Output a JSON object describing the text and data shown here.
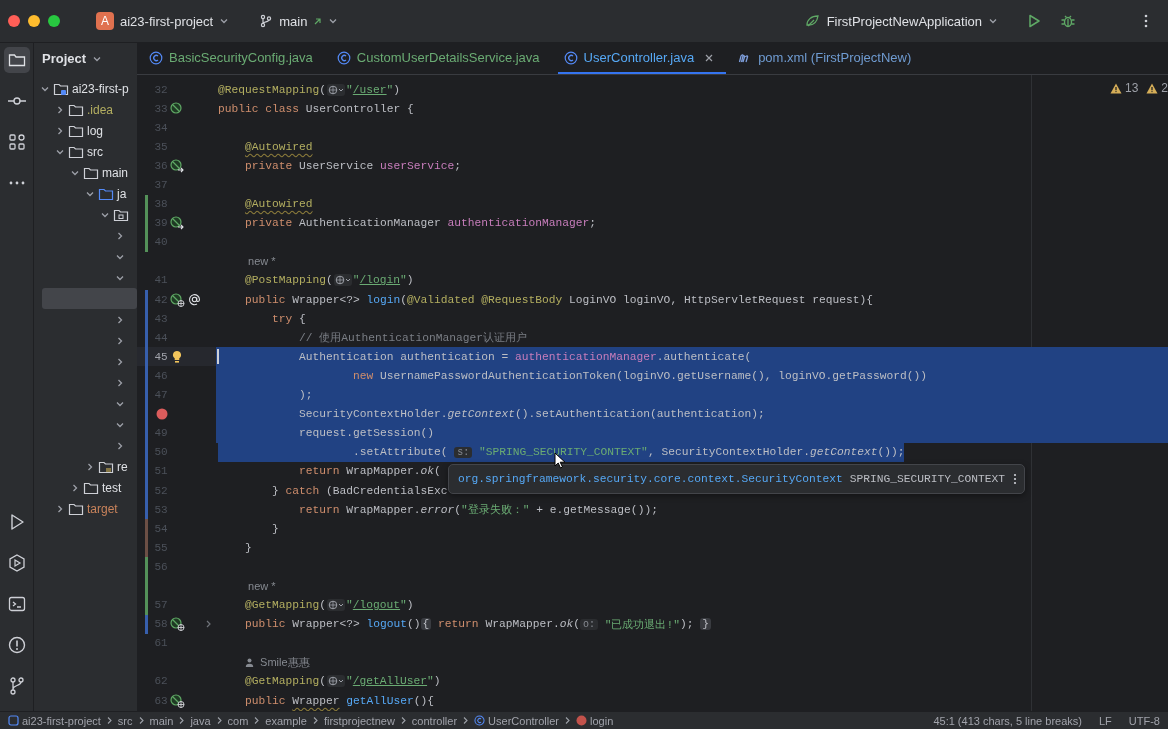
{
  "titlebar": {
    "project_badge": "A",
    "project": "ai23-first-project",
    "branch": "main",
    "run_config": "FirstProjectNewApplication"
  },
  "project": {
    "title": "Project",
    "tree": [
      {
        "label": "ai23-first-p",
        "kind": "module",
        "expanded": true,
        "selected": false,
        "children": [
          {
            "label": ".idea",
            "kind": "folder",
            "expanded": false,
            "selected": false,
            "color": "#b3ae60"
          },
          {
            "label": "log",
            "kind": "folder",
            "expanded": false,
            "selected": false
          },
          {
            "label": "src",
            "kind": "folder",
            "expanded": true,
            "selected": false,
            "children": [
              {
                "label": "main",
                "kind": "folder",
                "expanded": true,
                "selected": false,
                "children": [
                  {
                    "label": "ja",
                    "kind": "source",
                    "expanded": true,
                    "selected": false,
                    "children": [
                      {
                        "kind": "package",
                        "expanded": true,
                        "selected": false,
                        "children": [
                          {
                            "expanded": false,
                            "selected": false
                          },
                          {
                            "expanded": true,
                            "selected": false
                          },
                          {
                            "expanded": true,
                            "selected": false
                          },
                          {
                            "selected": true
                          },
                          {
                            "expanded": false,
                            "selected": false
                          },
                          {
                            "expanded": false,
                            "selected": false
                          },
                          {
                            "expanded": false,
                            "selected": false
                          },
                          {
                            "expanded": false,
                            "selected": false
                          },
                          {
                            "expanded": true,
                            "selected": false
                          },
                          {
                            "expanded": true,
                            "selected": false
                          },
                          {
                            "expanded": false,
                            "selected": false
                          }
                        ]
                      }
                    ]
                  },
                  {
                    "label": "re",
                    "kind": "resources",
                    "expanded": false,
                    "selected": false
                  }
                ]
              },
              {
                "label": "test",
                "kind": "folder",
                "expanded": false,
                "selected": false
              }
            ]
          },
          {
            "label": "target",
            "kind": "folder",
            "expanded": false,
            "selected": false,
            "color": "#c9835b"
          }
        ]
      }
    ]
  },
  "tabs": [
    {
      "label": "BasicSecurityConfig.java",
      "kind": "class",
      "selected": false,
      "color": "#6aab73"
    },
    {
      "label": "CustomUserDetailsService.java",
      "kind": "class",
      "selected": false,
      "color": "#6aab73"
    },
    {
      "label": "UserController.java",
      "kind": "class",
      "selected": true,
      "color": "#56a8f5"
    },
    {
      "label": "pom.xml (FirstProjectNew)",
      "kind": "maven",
      "selected": false,
      "color": "#6f9bd1"
    }
  ],
  "editor": {
    "warnings": [
      "13",
      "2"
    ],
    "lines": [
      {
        "kind": "code",
        "number": "32",
        "tokens": [
          {
            "kind": "ann",
            "text": "@RequestMapping"
          },
          {
            "kind": "p",
            "text": "("
          },
          {
            "kind": "globe"
          },
          {
            "kind": "str",
            "text": "\""
          },
          {
            "kind": "url",
            "text": "/user"
          },
          {
            "kind": "str",
            "text": "\""
          },
          {
            "kind": "p",
            "text": ")"
          }
        ]
      },
      {
        "kind": "code",
        "number": "33",
        "gutter": [
          {
            "kind": "bean"
          }
        ],
        "tokens": [
          {
            "kind": "kw",
            "text": "public class "
          },
          {
            "kind": "p",
            "text": "UserController {"
          }
        ]
      },
      {
        "kind": "code",
        "number": "34"
      },
      {
        "kind": "code",
        "number": "35",
        "tokens": [
          {
            "kind": "ann_warn",
            "text": "    @Autowired"
          }
        ]
      },
      {
        "kind": "code",
        "number": "36",
        "gutter": [
          {
            "kind": "bean_arrow"
          }
        ],
        "tokens": [
          {
            "kind": "kw",
            "text": "    private "
          },
          {
            "kind": "p",
            "text": "UserService "
          },
          {
            "kind": "field",
            "text": "userService"
          },
          {
            "kind": "p",
            "text": ";"
          }
        ]
      },
      {
        "kind": "code",
        "number": "37"
      },
      {
        "kind": "code",
        "number": "38",
        "color": "#549159",
        "tokens": [
          {
            "kind": "ann_warn",
            "text": "    @Autowired"
          }
        ]
      },
      {
        "kind": "code",
        "number": "39",
        "color": "#549159",
        "gutter": [
          {
            "kind": "bean_arrow"
          }
        ],
        "tokens": [
          {
            "kind": "kw",
            "text": "    private "
          },
          {
            "kind": "p",
            "text": "AuthenticationManager "
          },
          {
            "kind": "field",
            "text": "authenticationManager"
          },
          {
            "kind": "p",
            "text": ";"
          }
        ]
      },
      {
        "kind": "code",
        "number": "40",
        "color": "#549159"
      },
      {
        "kind": "inlay",
        "text": "new *"
      },
      {
        "kind": "code",
        "number": "41",
        "tokens": [
          {
            "kind": "ann",
            "text": "    @PostMapping"
          },
          {
            "kind": "p",
            "text": "("
          },
          {
            "kind": "globe"
          },
          {
            "kind": "str",
            "text": "\""
          },
          {
            "kind": "url",
            "text": "/login"
          },
          {
            "kind": "str",
            "text": "\""
          },
          {
            "kind": "p",
            "text": ")"
          }
        ]
      },
      {
        "kind": "code",
        "number": "42",
        "color": "#375fad",
        "gutter": [
          {
            "kind": "bean_globe"
          },
          {
            "kind": "at"
          }
        ],
        "tokens": [
          {
            "kind": "kw",
            "text": "    public "
          },
          {
            "kind": "p",
            "text": "Wrapper<?> "
          },
          {
            "kind": "fn",
            "text": "login"
          },
          {
            "kind": "p",
            "text": "("
          },
          {
            "kind": "ann",
            "text": "@Validated @RequestBody "
          },
          {
            "kind": "p",
            "text": "LoginVO loginVO, HttpServletRequest request){"
          }
        ]
      },
      {
        "kind": "code",
        "number": "43",
        "color": "#375fad",
        "tokens": [
          {
            "kind": "kw",
            "text": "        try "
          },
          {
            "kind": "p",
            "text": "{"
          }
        ]
      },
      {
        "kind": "code",
        "number": "44",
        "color": "#375fad",
        "tokens": [
          {
            "kind": "cm",
            "text": "            // 使用AuthenticationManager认证用户"
          }
        ]
      },
      {
        "kind": "code",
        "number": "45",
        "color": "#375fad",
        "current": true,
        "selected": true,
        "gutter": [
          {
            "kind": "bulb"
          }
        ],
        "tokens": [
          {
            "kind": "p",
            "text": "            Authentication authentication = "
          },
          {
            "kind": "field",
            "text": "authenticationManager"
          },
          {
            "kind": "p",
            "text": ".authenticate("
          }
        ]
      },
      {
        "kind": "code",
        "number": "46",
        "color": "#375fad",
        "selected": true,
        "tokens": [
          {
            "kind": "kw",
            "text": "                    new "
          },
          {
            "kind": "p",
            "text": "UsernamePasswordAuthenticationToken(loginVO.getUsername(), loginVO.getPassword())"
          }
        ]
      },
      {
        "kind": "code",
        "number": "47",
        "color": "#375fad",
        "selected": true,
        "tokens": [
          {
            "kind": "p",
            "text": "            );"
          }
        ]
      },
      {
        "kind": "code",
        "color": "#375fad",
        "selected": true,
        "gutter": [
          {
            "kind": "breakpoint"
          }
        ],
        "tokens": [
          {
            "kind": "p",
            "text": "            SecurityContextHolder."
          },
          {
            "kind": "it",
            "text": "getContext"
          },
          {
            "kind": "p",
            "text": "().setAuthentication(authentication);"
          }
        ]
      },
      {
        "kind": "code",
        "number": "49",
        "color": "#375fad",
        "selected": true,
        "tokens": [
          {
            "kind": "p",
            "text": "            request.getSession()"
          }
        ]
      },
      {
        "kind": "code",
        "number": "50",
        "color": "#375fad",
        "selected": true,
        "tokens": [
          {
            "kind": "p",
            "text": "                    .setAttribute( "
          },
          {
            "kind": "hint",
            "text": "s:"
          },
          {
            "kind": "str",
            "text": " \"SPRING_SECURITY_CONTEXT\""
          },
          {
            "kind": "p",
            "text": ", SecurityContextHolder."
          },
          {
            "kind": "it",
            "text": "getContext"
          },
          {
            "kind": "p",
            "text": "());"
          }
        ]
      },
      {
        "kind": "code",
        "number": "51",
        "color": "#375fad",
        "tokens": [
          {
            "kind": "kw",
            "text": "            return "
          },
          {
            "kind": "p",
            "text": "WrapMapper."
          },
          {
            "kind": "it",
            "text": "ok"
          },
          {
            "kind": "p",
            "text": "("
          }
        ]
      },
      {
        "kind": "code",
        "number": "52",
        "color": "#375fad",
        "tokens": [
          {
            "kind": "p",
            "text": "        } "
          },
          {
            "kind": "kw",
            "text": "catch "
          },
          {
            "kind": "p",
            "text": "(BadCredentialsExc"
          }
        ]
      },
      {
        "kind": "code",
        "number": "53",
        "color": "#375fad",
        "tokens": [
          {
            "kind": "kw",
            "text": "            return "
          },
          {
            "kind": "p",
            "text": "WrapMapper."
          },
          {
            "kind": "it",
            "text": "error"
          },
          {
            "kind": "p",
            "text": "("
          },
          {
            "kind": "str",
            "text": "\"登录失败：\""
          },
          {
            "kind": "p",
            "text": " + e.getMessage());"
          }
        ]
      },
      {
        "kind": "code",
        "number": "54",
        "color": "#6c4f45",
        "tokens": [
          {
            "kind": "p",
            "text": "        }"
          }
        ]
      },
      {
        "kind": "code",
        "number": "55",
        "color": "#6c4f45",
        "tokens": [
          {
            "kind": "p",
            "text": "    }"
          }
        ]
      },
      {
        "kind": "code",
        "number": "56",
        "color": "#549159"
      },
      {
        "kind": "inlay",
        "text": "new *",
        "color": "#549159"
      },
      {
        "kind": "code",
        "number": "57",
        "color": "#549159",
        "tokens": [
          {
            "kind": "ann",
            "text": "    @GetMapping"
          },
          {
            "kind": "p",
            "text": "("
          },
          {
            "kind": "globe"
          },
          {
            "kind": "str",
            "text": "\""
          },
          {
            "kind": "url",
            "text": "/logout"
          },
          {
            "kind": "str",
            "text": "\""
          },
          {
            "kind": "p",
            "text": ")"
          }
        ]
      },
      {
        "kind": "code",
        "number": "58",
        "color": "#375fad",
        "gutter": [
          {
            "kind": "bean_globe"
          },
          {
            "kind": "fold"
          }
        ],
        "tokens": [
          {
            "kind": "kw",
            "text": "    public "
          },
          {
            "kind": "p",
            "text": "Wrapper<?> "
          },
          {
            "kind": "fn",
            "text": "logout"
          },
          {
            "kind": "p",
            "text": "()"
          },
          {
            "kind": "fold",
            "text": "{"
          },
          {
            "kind": "kw",
            "text": " return "
          },
          {
            "kind": "p",
            "text": "WrapMapper."
          },
          {
            "kind": "it",
            "text": "ok"
          },
          {
            "kind": "p",
            "text": "("
          },
          {
            "kind": "hint",
            "text": "o:"
          },
          {
            "kind": "str",
            "text": " \"已成功退出!\""
          },
          {
            "kind": "p",
            "text": "); "
          },
          {
            "kind": "fold",
            "text": "}"
          }
        ]
      },
      {
        "kind": "code",
        "number": "61"
      },
      {
        "kind": "inlay",
        "text": "Smile惠惠",
        "author": true
      },
      {
        "kind": "code",
        "number": "62",
        "tokens": [
          {
            "kind": "ann",
            "text": "    @GetMapping"
          },
          {
            "kind": "p",
            "text": "("
          },
          {
            "kind": "globe"
          },
          {
            "kind": "str",
            "text": "\""
          },
          {
            "kind": "url",
            "text": "/getAllUser"
          },
          {
            "kind": "str",
            "text": "\""
          },
          {
            "kind": "p",
            "text": ")"
          }
        ]
      },
      {
        "kind": "code",
        "number": "63",
        "gutter": [
          {
            "kind": "bean_globe"
          }
        ],
        "tokens": [
          {
            "kind": "kw",
            "text": "    public "
          },
          {
            "kind": "p_warn",
            "text": "Wrapper"
          },
          {
            "kind": "fn",
            "text": " getAllUser"
          },
          {
            "kind": "p",
            "text": "(){"
          }
        ]
      }
    ],
    "tooltip": {
      "type": "org.springframework.security.core.context.SecurityContext",
      "name": "SPRING_SECURITY_CONTEXT"
    }
  },
  "status_bar": {
    "breadcrumbs": [
      {
        "label": "ai23-first-project",
        "kind": "module"
      },
      {
        "label": "src",
        "kind": "folder"
      },
      {
        "label": "main",
        "kind": "folder"
      },
      {
        "label": "java",
        "kind": "folder"
      },
      {
        "label": "com",
        "kind": "folder"
      },
      {
        "label": "example",
        "kind": "folder"
      },
      {
        "label": "firstprojectnew",
        "kind": "folder"
      },
      {
        "label": "controller",
        "kind": "folder"
      },
      {
        "label": "UserController",
        "kind": "class"
      },
      {
        "label": "login",
        "kind": "method"
      }
    ],
    "position": "45:1 (413 chars, 5 line breaks)",
    "line_ending": "LF",
    "encoding": "UTF-8"
  }
}
